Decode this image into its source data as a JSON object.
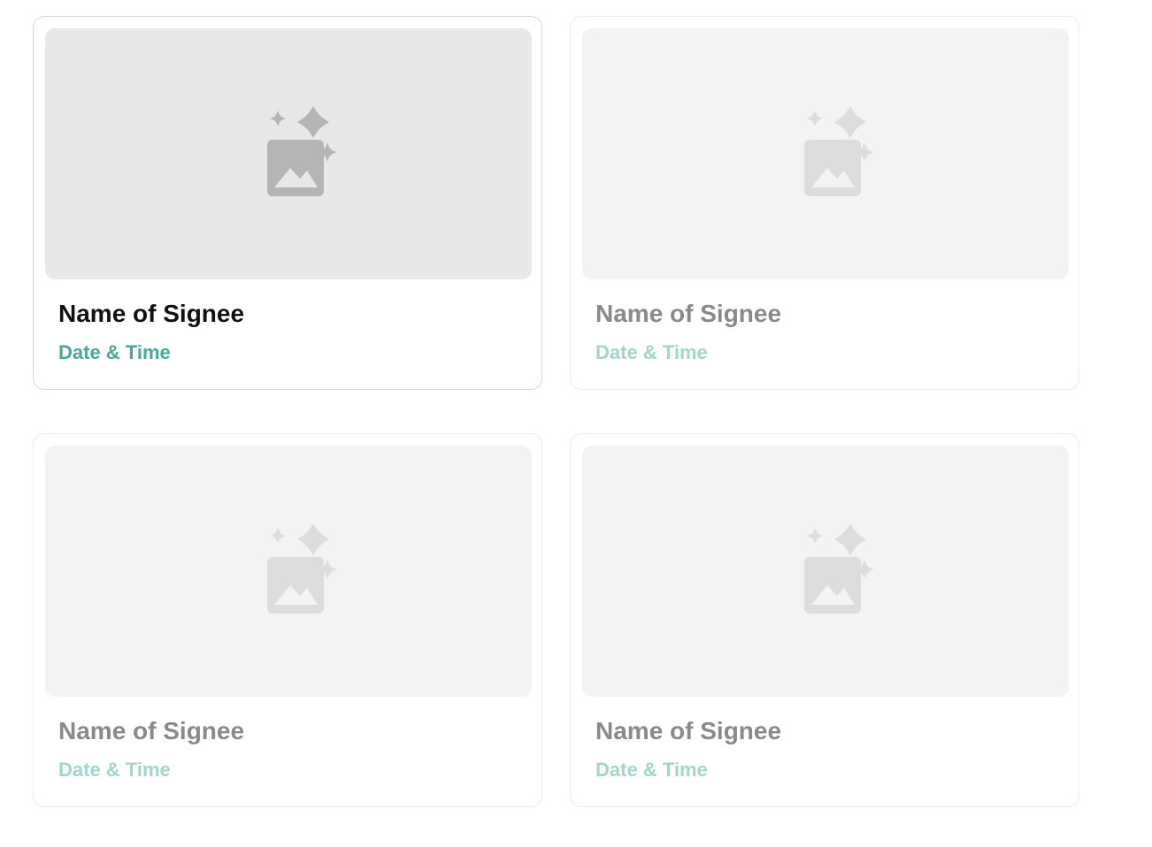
{
  "colors": {
    "accent_active": "#4aa896",
    "accent_inactive": "#a3d6cb",
    "text_active": "#111111",
    "text_inactive": "#8a8a8a"
  },
  "cards": [
    {
      "name": "Name of Signee",
      "datetime": "Date & Time",
      "icon": "image-sparkle-icon",
      "selected": true
    },
    {
      "name": "Name of Signee",
      "datetime": "Date & Time",
      "icon": "image-sparkle-icon",
      "selected": false
    },
    {
      "name": "Name of Signee",
      "datetime": "Date & Time",
      "icon": "image-sparkle-icon",
      "selected": false
    },
    {
      "name": "Name of Signee",
      "datetime": "Date & Time",
      "icon": "image-sparkle-icon",
      "selected": false
    }
  ]
}
